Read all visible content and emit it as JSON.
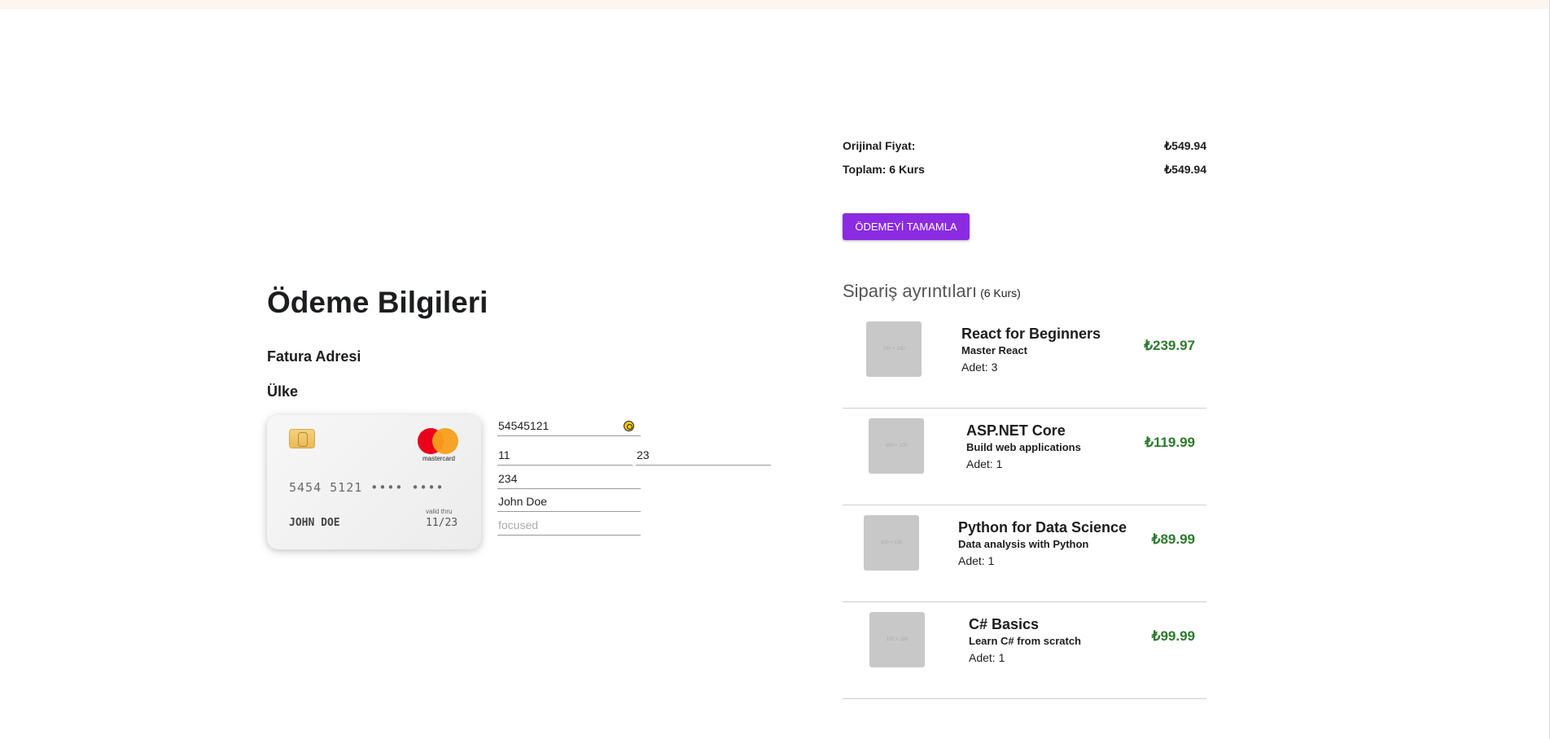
{
  "payment": {
    "title": "Ödeme Bilgileri",
    "billing_heading": "Fatura Adresi",
    "country_heading": "Ülke"
  },
  "card": {
    "brand": "mastercard",
    "number_display": "5454 5121 •••• ••••",
    "name_display": "JOHN DOE",
    "valid_label": "valid thru",
    "expiry_display": "11/23"
  },
  "form": {
    "card_number": "54545121",
    "expiry_month": "11",
    "expiry_year": "23",
    "cvc": "234",
    "name": "John Doe",
    "focused_placeholder": "focused"
  },
  "summary": {
    "original_label": "Orijinal Fiyat:",
    "original_value": "₺549.94",
    "total_label": "Toplam: 6 Kurs",
    "total_value": "₺549.94",
    "button_label": "ÖDEMEYİ TAMAMLA"
  },
  "order": {
    "heading": "Sipariş ayrıntıları",
    "count": "(6 Kurs)",
    "thumb_label": "100 × 100",
    "items": [
      {
        "title": "React for Beginners",
        "subtitle": "Master React",
        "qty": "Adet: 3",
        "price": "₺239.97"
      },
      {
        "title": "ASP.NET Core",
        "subtitle": "Build web applications",
        "qty": "Adet: 1",
        "price": "₺119.99"
      },
      {
        "title": "Python for Data Science",
        "subtitle": "Data analysis with Python",
        "qty": "Adet: 1",
        "price": "₺89.99"
      },
      {
        "title": "C# Basics",
        "subtitle": "Learn C# from scratch",
        "qty": "Adet: 1",
        "price": "₺99.99"
      }
    ]
  },
  "colors": {
    "accent": "#8a2be2",
    "price_green": "#2d7a2d",
    "top_bar": "#fdf5ef"
  }
}
